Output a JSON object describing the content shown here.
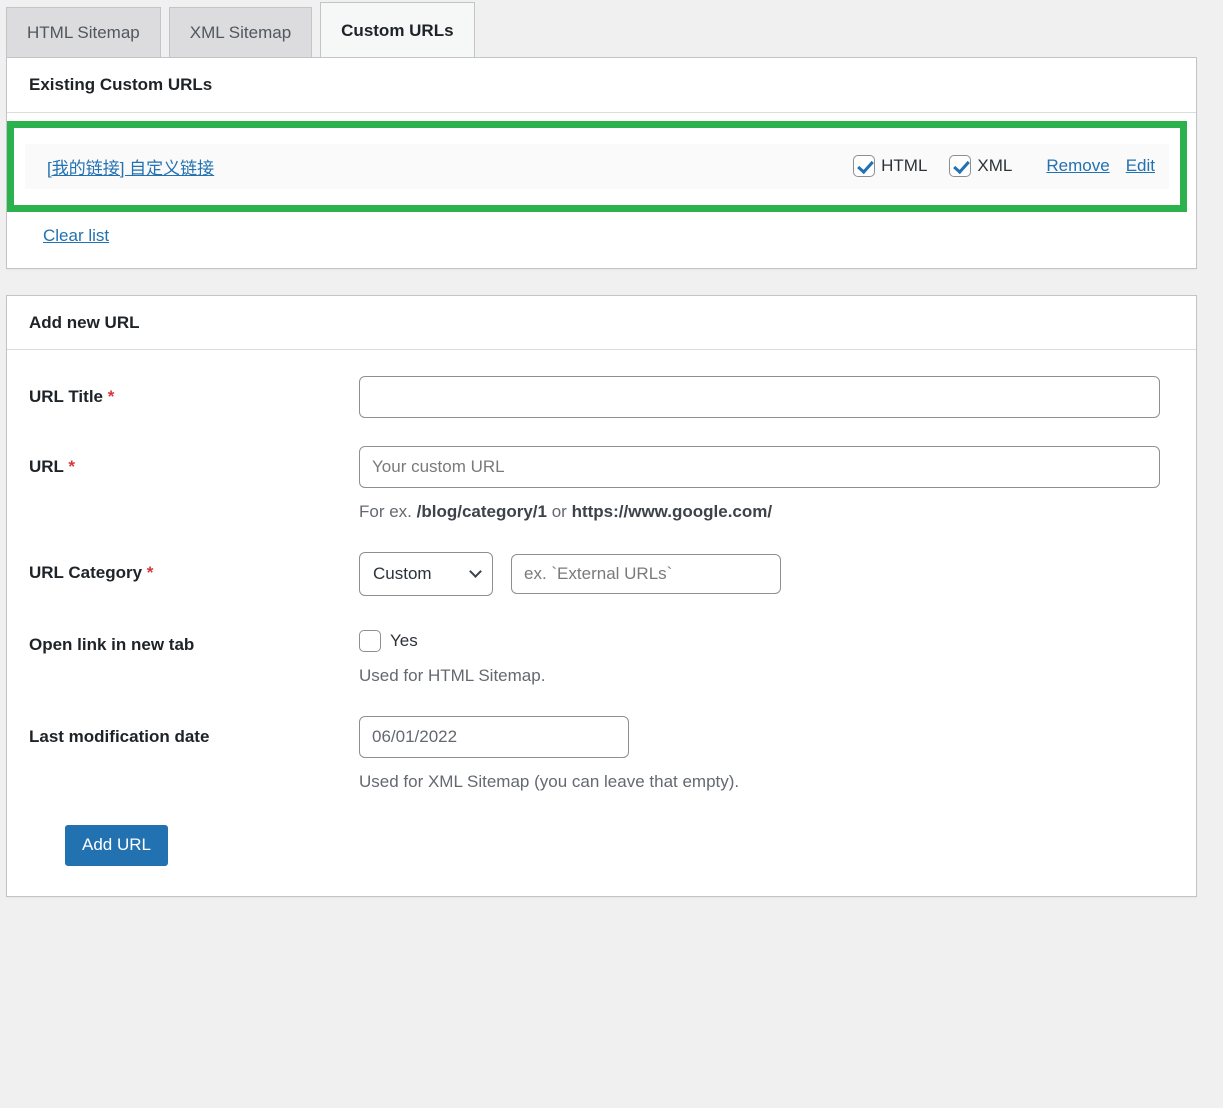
{
  "tabs": [
    {
      "label": "HTML Sitemap",
      "active": false
    },
    {
      "label": "XML Sitemap",
      "active": false
    },
    {
      "label": "Custom URLs",
      "active": true
    }
  ],
  "existing_panel": {
    "title": "Existing Custom URLs",
    "highlight_color": "#2bb24c",
    "rows": [
      {
        "link_text": "[我的链接] 自定义链接",
        "html_label": "HTML",
        "html_checked": true,
        "xml_label": "XML",
        "xml_checked": true,
        "remove_label": "Remove",
        "edit_label": "Edit"
      }
    ],
    "clear_list_label": "Clear list"
  },
  "add_panel": {
    "title": "Add new URL",
    "fields": {
      "url_title": {
        "label": "URL Title",
        "required_mark": "*",
        "value": "",
        "placeholder": ""
      },
      "url": {
        "label": "URL",
        "required_mark": "*",
        "value": "",
        "placeholder": "Your custom URL",
        "hint_prefix": "For ex. ",
        "hint_example_1": "/blog/category/1",
        "hint_join": " or ",
        "hint_example_2": "https://www.google.com/"
      },
      "url_category": {
        "label": "URL Category",
        "required_mark": "*",
        "selected": "Custom",
        "options": [
          "Custom"
        ],
        "custom_value": "",
        "custom_placeholder": "ex. `External URLs`"
      },
      "open_new_tab": {
        "label": "Open link in new tab",
        "checkbox_label": "Yes",
        "checked": false,
        "hint": "Used for HTML Sitemap."
      },
      "last_modified": {
        "label": "Last modification date",
        "value": "06/01/2022",
        "hint": "Used for XML Sitemap (you can leave that empty)."
      }
    },
    "submit_label": "Add URL",
    "accent_color": "#2271b1"
  }
}
